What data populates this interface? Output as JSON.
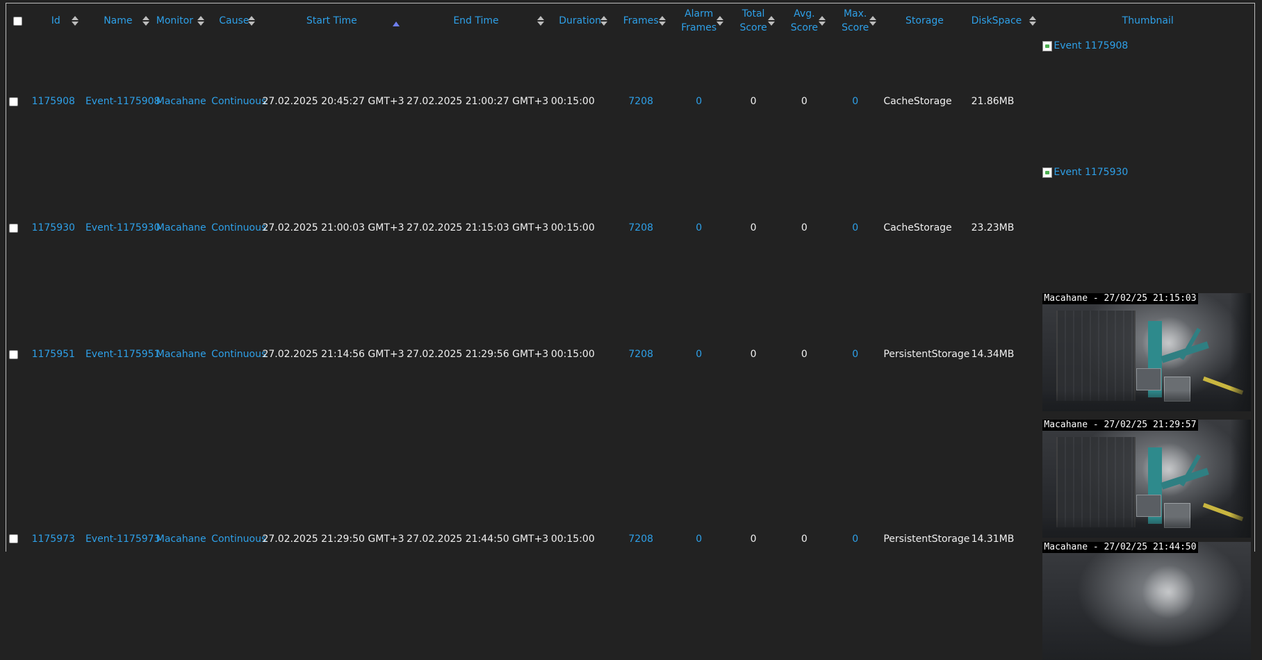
{
  "headers": {
    "id": "Id",
    "name": "Name",
    "monitor": "Monitor",
    "cause": "Cause",
    "start_time": "Start Time",
    "end_time": "End Time",
    "duration": "Duration",
    "frames": "Frames",
    "alarm_frames_1": "Alarm",
    "alarm_frames_2": "Frames",
    "total_score_1": "Total",
    "total_score_2": "Score",
    "avg_score_1": "Avg.",
    "avg_score_2": "Score",
    "max_score_1": "Max.",
    "max_score_2": "Score",
    "storage": "Storage",
    "disk_space": "DiskSpace",
    "thumbnail": "Thumbnail"
  },
  "rows": [
    {
      "id": "1175908",
      "name": "Event-1175908",
      "monitor": "Macahane",
      "cause": "Continuous",
      "start": "27.02.2025 20:45:27 GMT+3",
      "end": "27.02.2025 21:00:27 GMT+3",
      "duration": "00:15:00",
      "frames": "7208",
      "alarm_frames": "0",
      "total_score": "0",
      "avg_score": "0",
      "max_score": "0",
      "storage": "CacheStorage",
      "disk_space": "21.86MB",
      "thumb_alt": "Event 1175908",
      "thumb_ts": ""
    },
    {
      "id": "1175930",
      "name": "Event-1175930",
      "monitor": "Macahane",
      "cause": "Continuous",
      "start": "27.02.2025 21:00:03 GMT+3",
      "end": "27.02.2025 21:15:03 GMT+3",
      "duration": "00:15:00",
      "frames": "7208",
      "alarm_frames": "0",
      "total_score": "0",
      "avg_score": "0",
      "max_score": "0",
      "storage": "CacheStorage",
      "disk_space": "23.23MB",
      "thumb_alt": "Event 1175930",
      "thumb_ts": ""
    },
    {
      "id": "1175951",
      "name": "Event-1175951",
      "monitor": "Macahane",
      "cause": "Continuous",
      "start": "27.02.2025 21:14:56 GMT+3",
      "end": "27.02.2025 21:29:56 GMT+3",
      "duration": "00:15:00",
      "frames": "7208",
      "alarm_frames": "0",
      "total_score": "0",
      "avg_score": "0",
      "max_score": "0",
      "storage": "PersistentStorage",
      "disk_space": "14.34MB",
      "thumb_alt": "",
      "thumb_ts": "Macahane - 27/02/25 21:15:03"
    },
    {
      "id": "1175973",
      "name": "Event-1175973",
      "monitor": "Macahane",
      "cause": "Continuous",
      "start": "27.02.2025 21:29:50 GMT+3",
      "end": "27.02.2025 21:44:50 GMT+3",
      "duration": "00:15:00",
      "frames": "7208",
      "alarm_frames": "0",
      "total_score": "0",
      "avg_score": "0",
      "max_score": "0",
      "storage": "PersistentStorage",
      "disk_space": "14.31MB",
      "thumb_alt": "",
      "thumb_ts": "Macahane - 27/02/25 21:29:57"
    }
  ],
  "next_thumb_ts": "Macahane - 27/02/25 21:44:50",
  "colors": {
    "link": "#2ea0e8",
    "background": "#222222",
    "text": "#f0f0f0",
    "sort_active": "#6f7ff0"
  },
  "sort": {
    "column": "start_time",
    "direction": "ascending"
  }
}
